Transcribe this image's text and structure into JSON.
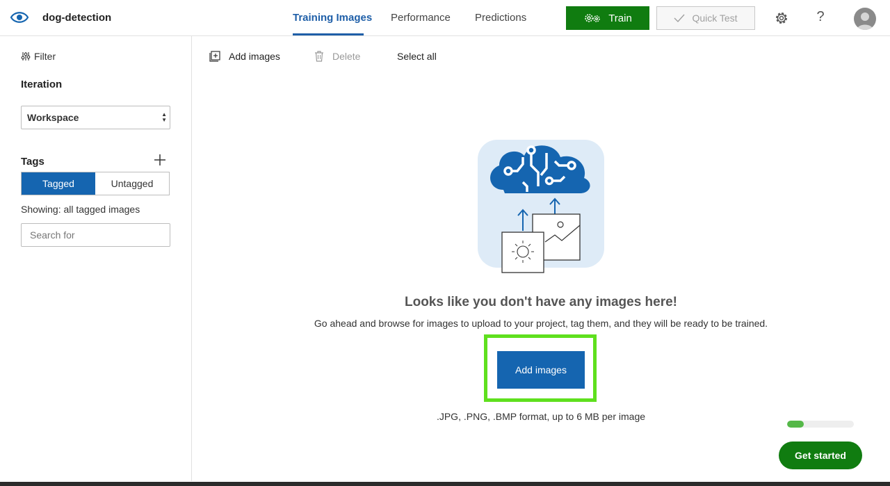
{
  "header": {
    "project_name": "dog-detection",
    "tabs": [
      {
        "label": "Training Images",
        "active": true
      },
      {
        "label": "Performance",
        "active": false
      },
      {
        "label": "Predictions",
        "active": false
      }
    ],
    "train_label": "Train",
    "quick_test_label": "Quick Test",
    "help_label": "?"
  },
  "sidebar": {
    "filter_label": "Filter",
    "iteration_label": "Iteration",
    "iteration_value": "Workspace",
    "tags_label": "Tags",
    "toggle": {
      "tagged": "Tagged",
      "untagged": "Untagged",
      "selected": "Tagged"
    },
    "showing_text": "Showing: all tagged images",
    "search_placeholder": "Search for"
  },
  "toolbar": {
    "add_images_label": "Add images",
    "delete_label": "Delete",
    "select_all_label": "Select all"
  },
  "empty_state": {
    "title": "Looks like you don't have any images here!",
    "description": "Go ahead and browse for images to upload to your project, tag them, and they will be ready to be trained.",
    "add_button_label": "Add images",
    "formats_note": ".JPG, .PNG, .BMP format, up to 6 MB per image"
  },
  "onboarding": {
    "progress_fraction": 0.25,
    "get_started_label": "Get started"
  },
  "colors": {
    "brand_blue": "#1565b0",
    "train_green": "#107c10",
    "highlight_green": "#5fe01e",
    "progress_green": "#55b848"
  }
}
